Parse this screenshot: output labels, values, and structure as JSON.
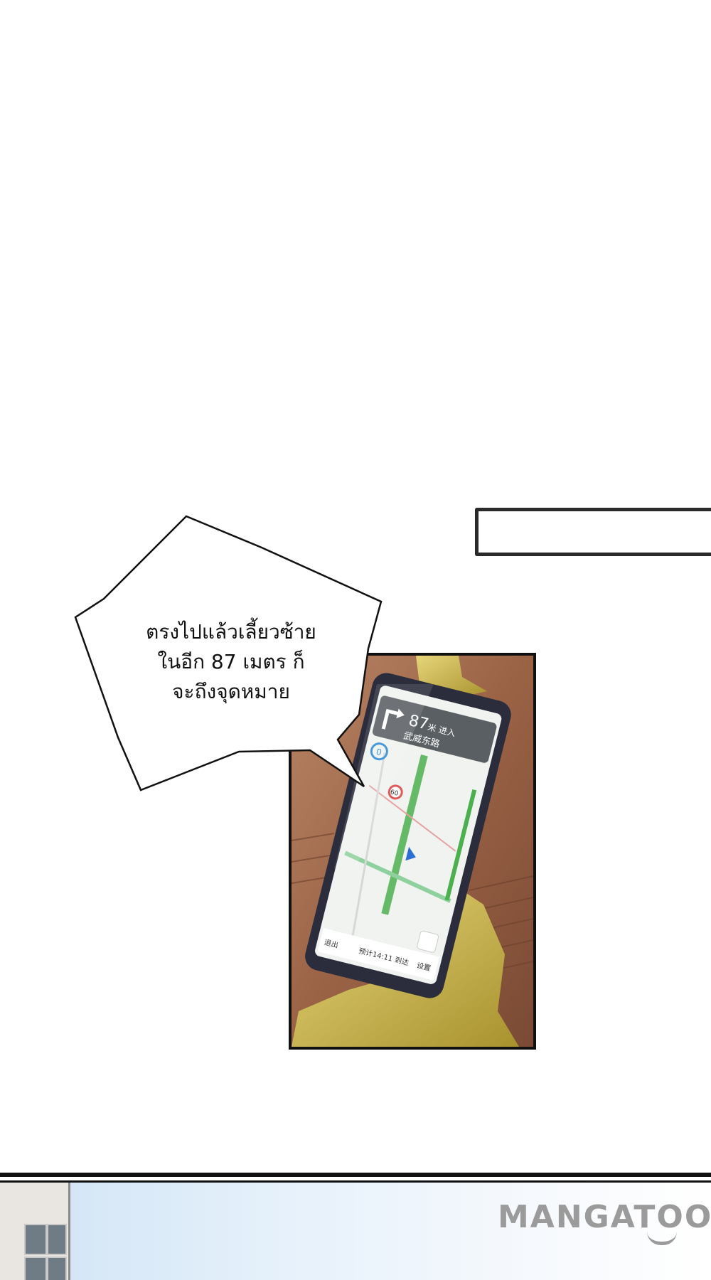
{
  "speech_bubble": {
    "lines": [
      "ตรงไปแล้วเลี้ยวซ้าย",
      "ในอีก 87 เมตร ก็",
      "จะถึงจุดหมาย"
    ]
  },
  "phone_screen": {
    "distance": "87",
    "distance_unit": "米 进入",
    "road_name": "武威东路",
    "speed_limit": "60",
    "eta": "预计14:11 到达",
    "exit_label": "退出",
    "settings_label": "设置",
    "compass_letter": "0"
  },
  "watermark": {
    "text": "MANGATOON"
  },
  "colors": {
    "background": "#ffffff",
    "panel_border": "#111111",
    "watermark": "#9b9b9b"
  }
}
